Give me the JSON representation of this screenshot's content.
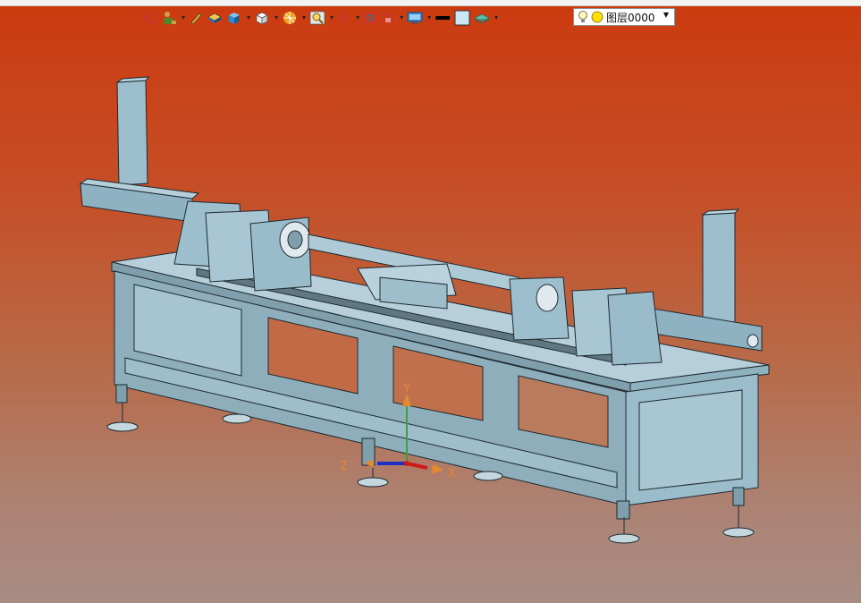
{
  "toolbar": {
    "buttons": [
      {
        "icon": "exit-icon",
        "dropdown": false
      },
      {
        "icon": "user-style-icon",
        "dropdown": true
      },
      {
        "icon": "pen-icon",
        "dropdown": false
      },
      {
        "icon": "sheet-solid-icon",
        "dropdown": false
      },
      {
        "icon": "cube-shaded-icon",
        "dropdown": true
      },
      {
        "icon": "cube-white-icon",
        "dropdown": true
      },
      {
        "icon": "view-orientation-icon",
        "dropdown": true
      },
      {
        "icon": "zoom-icon",
        "dropdown": true
      },
      {
        "icon": "pan-icon",
        "dropdown": true
      },
      {
        "icon": "rotate-icon",
        "dropdown": false
      },
      {
        "icon": "section-icon",
        "dropdown": true
      },
      {
        "icon": "display-icon",
        "dropdown": true
      },
      {
        "icon": "line-color-icon",
        "dropdown": false
      },
      {
        "icon": "fill-color-icon",
        "dropdown": false
      },
      {
        "icon": "layer-manager-icon",
        "dropdown": true
      }
    ],
    "layer_select": {
      "value": "图层0000",
      "bulb_color": "#ffe100"
    }
  },
  "viewport": {
    "background_top": "#cc3a0f",
    "background_bottom": "#a88c82",
    "model_color": "#8fb4c4",
    "axes": {
      "x": "X",
      "y": "Y",
      "z": "Z"
    }
  }
}
